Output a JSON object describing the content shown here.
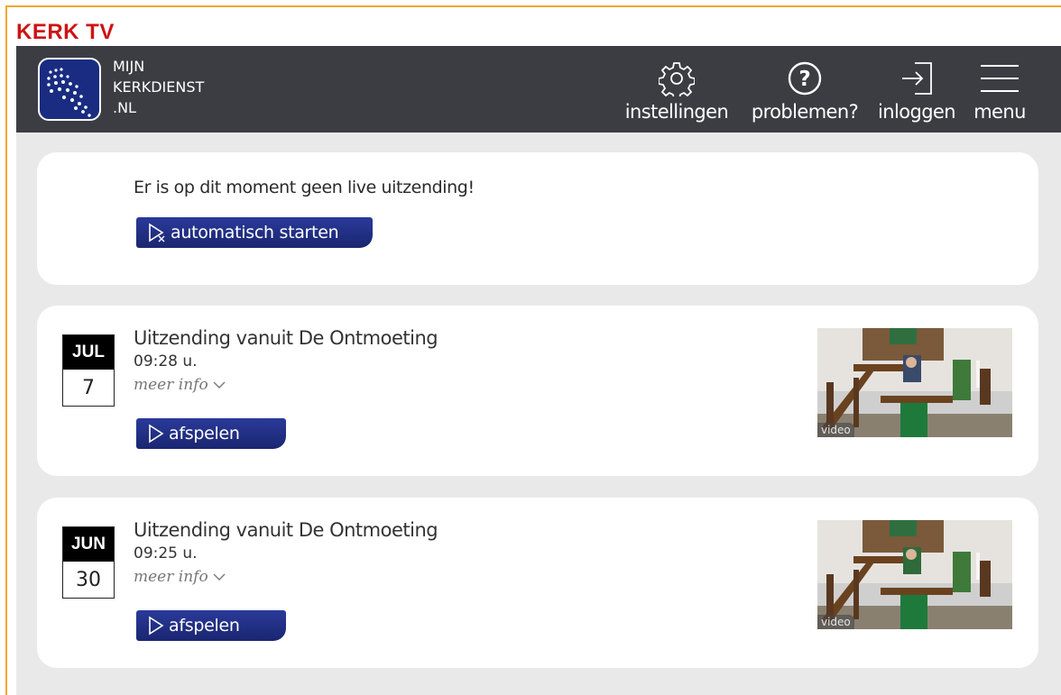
{
  "site": {
    "title": "KERK TV"
  },
  "header": {
    "logo_lines": [
      "MIJN",
      "KERKDIENST",
      ".NL"
    ],
    "nav": [
      {
        "label": "instellingen",
        "icon": "gear-icon"
      },
      {
        "label": "problemen?",
        "icon": "question-icon"
      },
      {
        "label": "inloggen",
        "icon": "login-icon"
      },
      {
        "label": "menu",
        "icon": "hamburger-icon"
      }
    ]
  },
  "notice": {
    "text": "Er is op dit moment geen live uitzending!",
    "button_label": "automatisch starten"
  },
  "broadcasts": [
    {
      "month": "JUL",
      "day": "7",
      "title": "Uitzending vanuit De Ontmoeting",
      "time": "09:28 u.",
      "more_info": "meer info",
      "play_label": "afspelen",
      "thumb_label": "video"
    },
    {
      "month": "JUN",
      "day": "30",
      "title": "Uitzending vanuit De Ontmoeting",
      "time": "09:25 u.",
      "more_info": "meer info",
      "play_label": "afspelen",
      "thumb_label": "video"
    }
  ],
  "colors": {
    "brand_red": "#cc1414",
    "header_bg": "#3b3d43",
    "button_blue": "#1a2670",
    "frame_orange": "#f3a733"
  }
}
